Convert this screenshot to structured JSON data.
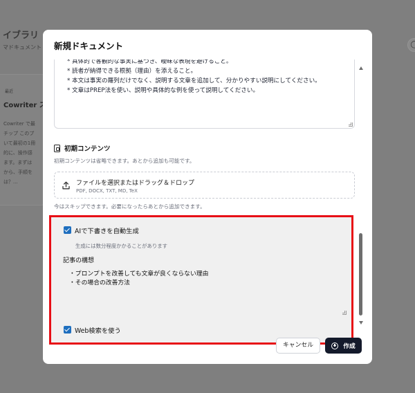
{
  "background": {
    "page_title": "イブラリ",
    "page_subtitle": "マドキュメント",
    "card": {
      "tag": "最近",
      "title": "Cowriter ス",
      "lines": [
        "Cowriter で最",
        "チップ このプ",
        "いて最初の1冊",
        "的に、操作感",
        "ます。まずは",
        "から、手順を",
        "は？..."
      ]
    },
    "right_button_icon": "circle-icon"
  },
  "modal": {
    "title": "新規ドキュメント",
    "instructions_lines": [
      "* 具体的で客観的な事実に基づき、曖昧な表現を避けること。",
      "* 読者が納得できる根拠（理由）を添えること。",
      "* 本文は事実の羅列だけでなく、説明する文章を追加して、分かりやすい説明にしてください。",
      "* 文章はPREP法を使い、説明や具体的な例を使って説明してください。"
    ],
    "initial_content": {
      "icon": "file-icon",
      "title": "初期コンテンツ",
      "description": "初期コンテンツは省略できます。あとから追加も可能です。",
      "dropzone": {
        "icon": "upload-icon",
        "title": "ファイルを選択またはドラッグ＆ドロップ",
        "formats": "PDF, DOCX, TXT, MD, TeX"
      },
      "skip_note": "今はスキップできます。必要になったらあとから追加できます。"
    },
    "ai_section": {
      "auto_draft_label": "AIで下書きを自動生成",
      "auto_draft_checked": true,
      "auto_draft_note": "生成には数分程度かかることがあります",
      "outline_label": "記事の構想",
      "outline_lines": [
        "・プロンプトを改善しても文章が良くならない理由",
        "・その場合の改善方法"
      ],
      "web_search_label": "Web検索を使う",
      "web_search_checked": true,
      "highlight_color": "#e80f16"
    },
    "buttons": {
      "cancel_label": "キャンセル",
      "create_label": "作成",
      "create_icon": "plus-circle-icon"
    }
  }
}
